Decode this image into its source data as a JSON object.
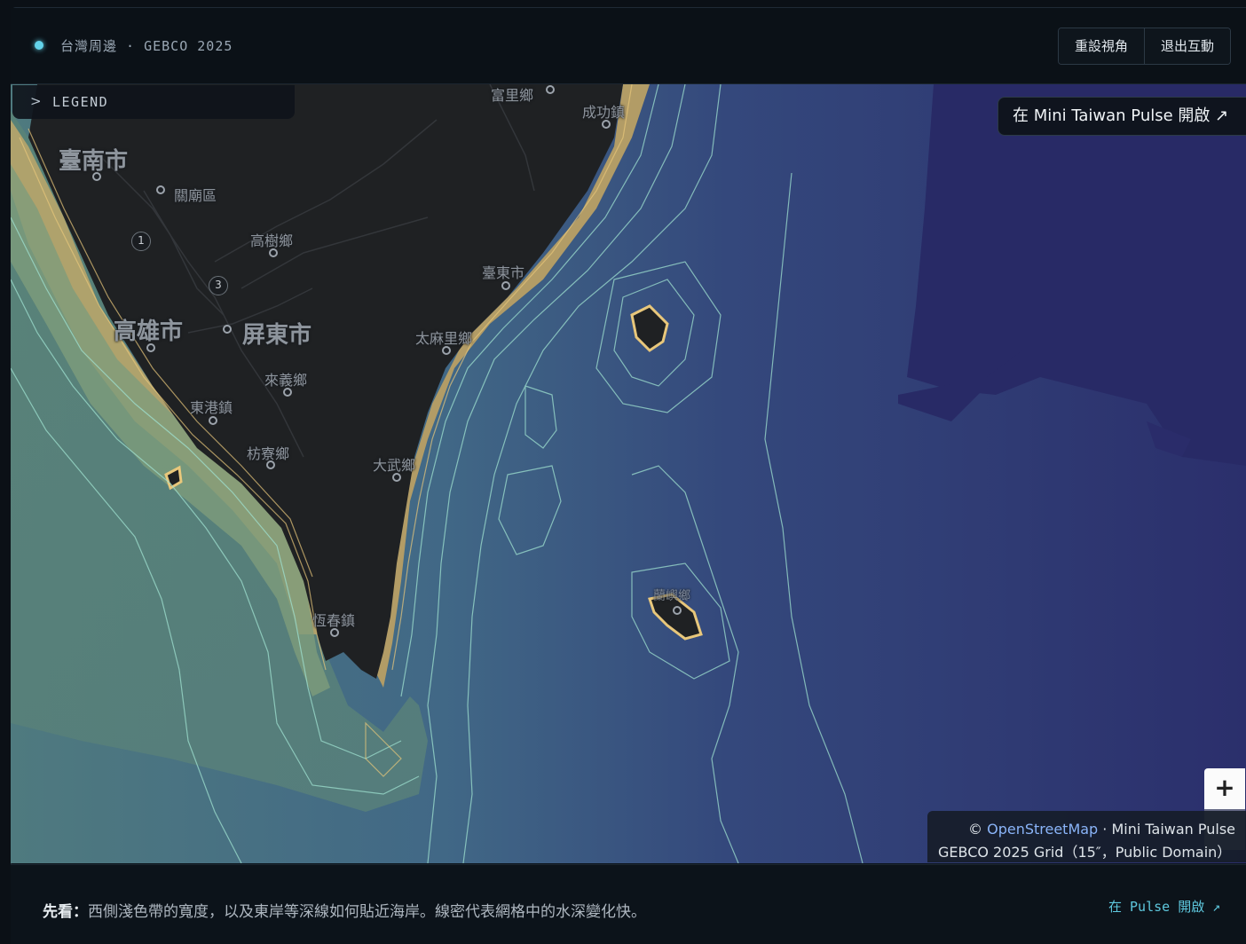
{
  "header": {
    "title": "台灣周邊 · GEBCO 2025",
    "reset_view_label": "重設視角",
    "exit_interact_label": "退出互動",
    "status_color": "#63d3ea"
  },
  "legend": {
    "label": "LEGEND",
    "expand_icon": "chevron-right-icon"
  },
  "map": {
    "open_in_pulse_label": "在 Mini Taiwan Pulse 開啟 ↗",
    "zoom_in_label": "+",
    "labels": {
      "tainan": "臺南市",
      "guanmiao": "關廟區",
      "gaoshu": "高樹鄉",
      "kaohsiung": "高雄市",
      "pingtung": "屏東市",
      "laiyi": "來義鄉",
      "donggang": "東港鎮",
      "fangliao": "枋寮鄉",
      "hengchun": "恆春鎮",
      "fuli": "富里鄉",
      "chenggong": "成功鎮",
      "taitung": "臺東市",
      "taimali": "太麻里鄉",
      "dawu": "大武鄉",
      "lanyu": "蘭嶼鄉"
    },
    "shields": {
      "s1": "1",
      "s3": "3"
    },
    "attribution": {
      "prefix": "© ",
      "osm_link": "OpenStreetMap",
      "suffix": " · Mini Taiwan Pulse",
      "line2": "GEBCO 2025 Grid（15″，Public Domain）"
    },
    "colors": {
      "land": "#1f2123",
      "deep_ocean": "#2a2f6e",
      "mid_ocean": "#3e5b86",
      "shallow": "#b9a56a",
      "contour": "#9ee0cf"
    }
  },
  "footer": {
    "note_bold": "先看：",
    "note_text": "西側淺色帶的寬度，以及東岸等深線如何貼近海岸。線密代表網格中的水深變化快。",
    "open_link": "在 Pulse 開啟 ↗"
  }
}
